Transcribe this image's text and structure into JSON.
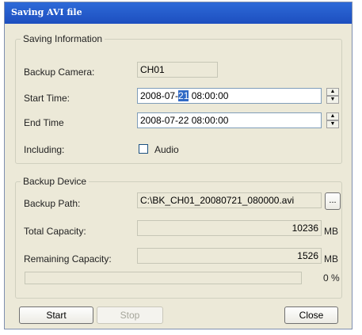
{
  "window": {
    "title": "Saving AVI file"
  },
  "saving_info": {
    "legend": "Saving Information",
    "camera_label": "Backup Camera:",
    "camera_value": "CH01",
    "start_label": "Start Time:",
    "start_value_pre": "2008-07-",
    "start_value_sel": "21",
    "start_value_post": " 08:00:00",
    "end_label": "End Time",
    "end_value": "2008-07-22 08:00:00",
    "including_label": "Including:",
    "audio_label": "Audio",
    "audio_checked": false
  },
  "backup_device": {
    "legend": "Backup Device",
    "path_label": "Backup Path:",
    "path_value": "C:\\BK_CH01_20080721_080000.avi",
    "browse_label": "...",
    "total_label": "Total Capacity:",
    "total_value": "10236",
    "total_unit": "MB",
    "remaining_label": "Remaining Capacity:",
    "remaining_value": "1526",
    "remaining_unit": "MB",
    "progress_percent": 0,
    "progress_text": "0 %"
  },
  "buttons": {
    "start": "Start",
    "stop": "Stop",
    "close": "Close"
  },
  "colors": {
    "titlebar": "#1d4fbf",
    "dialog_bg": "#ECE9D8",
    "selection": "#316ac5"
  }
}
